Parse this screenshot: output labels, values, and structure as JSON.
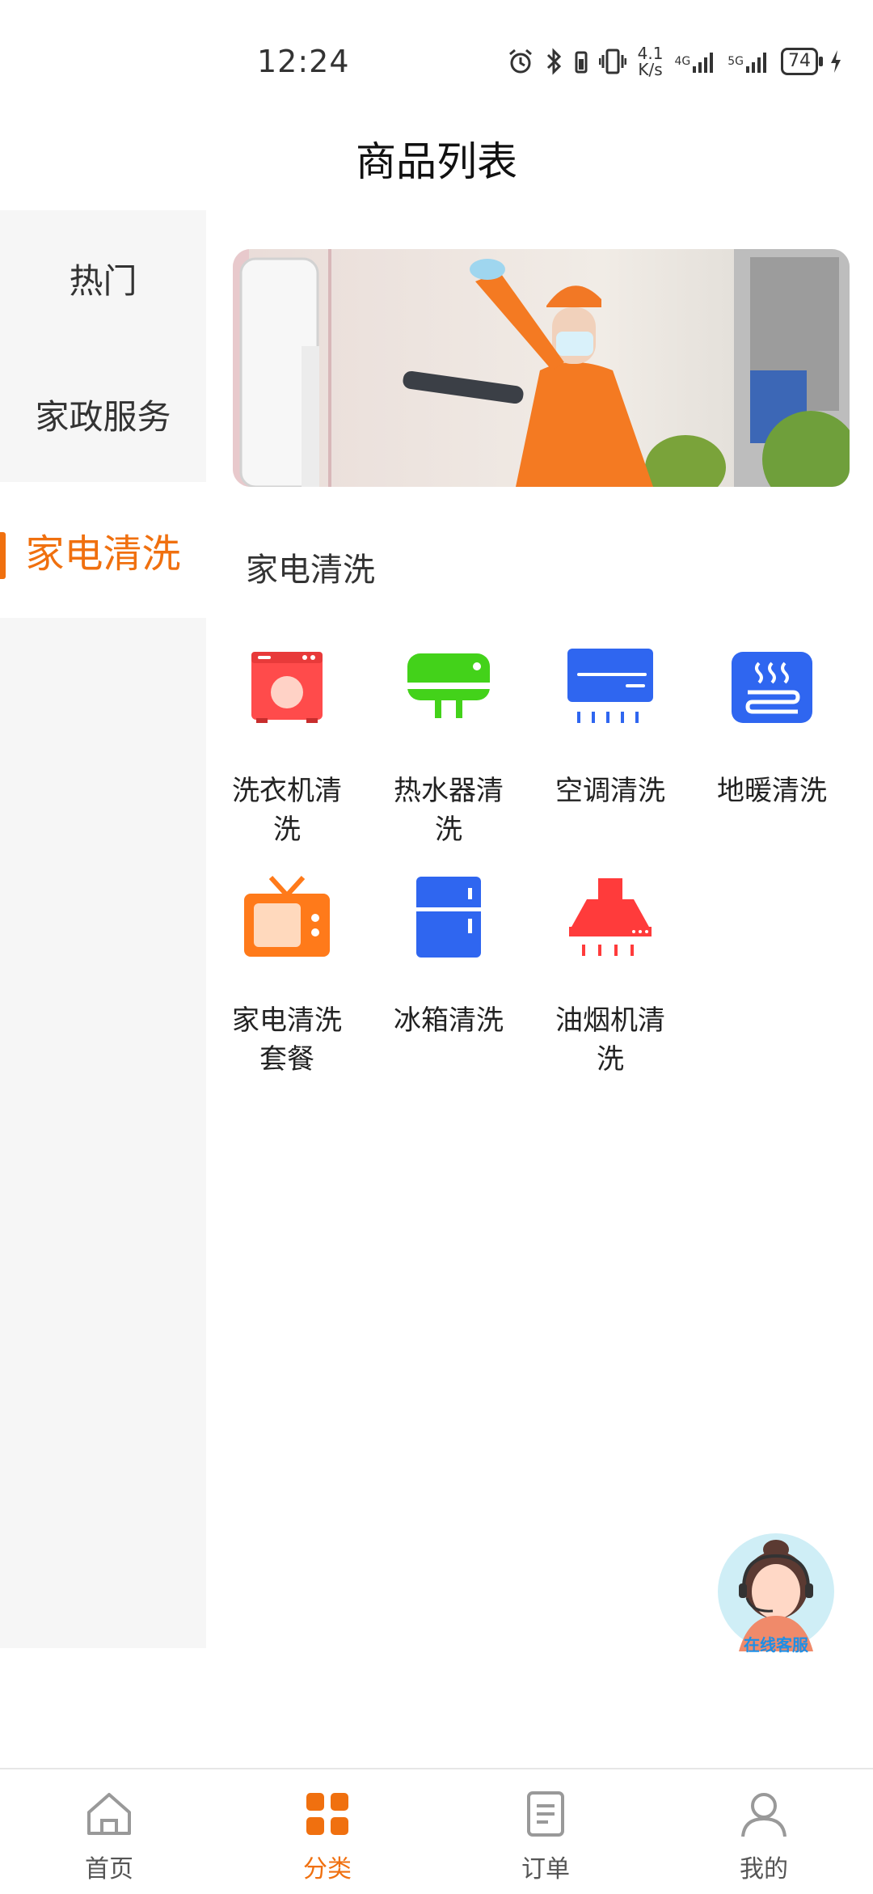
{
  "status_bar": {
    "time": "12:24",
    "net_speed_value": "4.1",
    "net_speed_unit": "K/s",
    "net_4g": "4G",
    "net_5g": "5G",
    "battery": "74"
  },
  "header": {
    "title": "商品列表"
  },
  "sidebar": {
    "items": [
      {
        "label": "热门"
      },
      {
        "label": "家政服务"
      },
      {
        "label": "家电清洗"
      }
    ],
    "active_index": 2
  },
  "main": {
    "section_title": "家电清洗",
    "services": [
      {
        "label": "洗衣机清洗",
        "icon": "washing-machine-icon"
      },
      {
        "label": "热水器清洗",
        "icon": "water-heater-icon"
      },
      {
        "label": "空调清洗",
        "icon": "air-conditioner-icon"
      },
      {
        "label": "地暖清洗",
        "icon": "floor-heating-icon"
      },
      {
        "label": "家电清洗套餐",
        "icon": "tv-icon"
      },
      {
        "label": "冰箱清洗",
        "icon": "refrigerator-icon"
      },
      {
        "label": "油烟机清洗",
        "icon": "range-hood-icon"
      }
    ]
  },
  "service_fab": {
    "label": "在线客服",
    "icon": "customer-service-avatar-icon"
  },
  "bottom_nav": {
    "items": [
      {
        "label": "首页",
        "icon": "home-icon"
      },
      {
        "label": "分类",
        "icon": "category-grid-icon"
      },
      {
        "label": "订单",
        "icon": "order-document-icon"
      },
      {
        "label": "我的",
        "icon": "user-profile-icon"
      }
    ],
    "active_index": 1
  },
  "colors": {
    "accent": "#f0700f",
    "sidebar_bg": "#f6f6f6",
    "service_blue": "#1e8fe6"
  }
}
